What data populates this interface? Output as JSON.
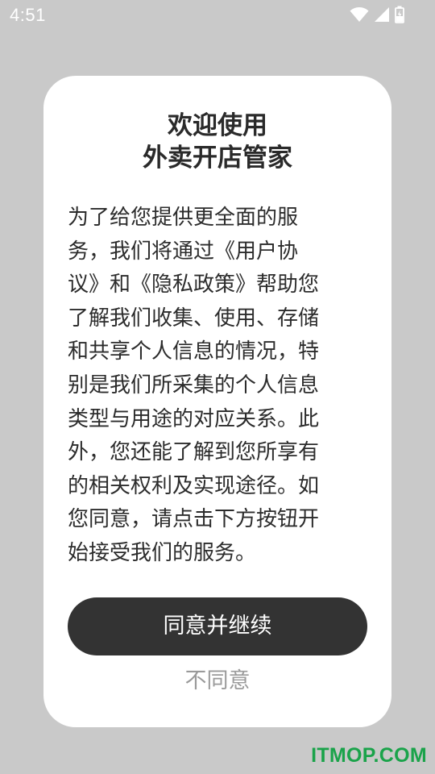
{
  "status_bar": {
    "time": "4:51",
    "icons": [
      "wifi-icon",
      "cellular-signal-icon",
      "battery-charging-icon"
    ],
    "icon_color": "#ffffff"
  },
  "dialog": {
    "title_lines": [
      "欢迎使用",
      "外卖开店管家"
    ],
    "body_lines": [
      "为了给您提供更全面的服",
      "务，我们将通过《用户协",
      "议》和《隐私政策》帮助您",
      "了解我们收集、使用、存储",
      "和共享个人信息的情况，特",
      "别是我们所采集的个人信息",
      "类型与用途的对应关系。此",
      "外，您还能了解到您所享有",
      "的相关权利及实现途径。如",
      "您同意，请点击下方按钮开",
      "始接受我们的服务。"
    ],
    "agree_label": "同意并继续",
    "disagree_label": "不同意"
  },
  "watermark": "ITMOP.COM",
  "colors": {
    "overlay_background": "#c9c9c9",
    "dialog_background": "#ffffff",
    "primary_button": "#333333",
    "secondary_text": "#9a9a9a",
    "watermark": "#1aa34a"
  }
}
